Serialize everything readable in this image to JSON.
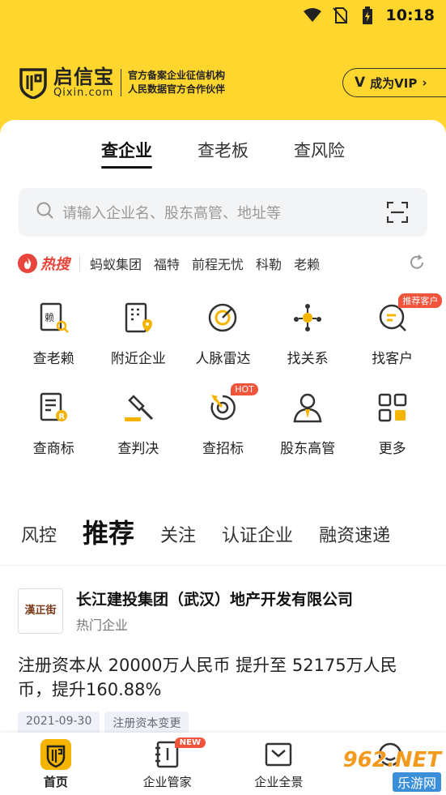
{
  "status_bar": {
    "time": "10:18"
  },
  "brand": {
    "name": "启信宝",
    "domain": "Qixin.com",
    "desc_line1": "官方备案企业征信机构",
    "desc_line2": "人民数据官方合作伙伴",
    "vip_label": "成为VIP"
  },
  "search_tabs": [
    "查企业",
    "查老板",
    "查风险"
  ],
  "search": {
    "placeholder": "请输入企业名、股东高管、地址等"
  },
  "hot_search": {
    "label": "热搜",
    "items": [
      "蚂蚁集团",
      "福特",
      "前程无忧",
      "科勒",
      "老赖"
    ]
  },
  "grid": [
    {
      "label": "查老赖",
      "icon": "debtor-icon"
    },
    {
      "label": "附近企业",
      "icon": "nearby-company-icon"
    },
    {
      "label": "人脉雷达",
      "icon": "radar-icon"
    },
    {
      "label": "找关系",
      "icon": "relationship-icon"
    },
    {
      "label": "找客户",
      "icon": "find-customer-icon",
      "badge": "推荐客户"
    },
    {
      "label": "查商标",
      "icon": "trademark-icon"
    },
    {
      "label": "查判决",
      "icon": "gavel-icon"
    },
    {
      "label": "查招标",
      "icon": "bidding-icon",
      "badge": "HOT"
    },
    {
      "label": "股东高管",
      "icon": "shareholder-icon"
    },
    {
      "label": "更多",
      "icon": "more-grid-icon"
    }
  ],
  "feed_tabs": [
    "风控",
    "推荐",
    "关注",
    "认证企业",
    "融资速递"
  ],
  "news": {
    "logo_text": "漢正街",
    "company": "长江建投集团（武汉）地产开发有限公司",
    "sub": "热门企业",
    "body": "注册资本从 20000万人民币 提升至 52175万人民币，提升160.88%",
    "tags": [
      "2021-09-30",
      "注册资本变更"
    ]
  },
  "bottom_nav": [
    {
      "label": "首页",
      "icon": "home-icon"
    },
    {
      "label": "企业管家",
      "icon": "notebook-icon",
      "badge": "NEW"
    },
    {
      "label": "企业全景",
      "icon": "panorama-icon"
    },
    {
      "label": "",
      "icon": "profile-icon"
    }
  ],
  "watermark": {
    "num": "962.NET",
    "sub": "乐游网"
  }
}
